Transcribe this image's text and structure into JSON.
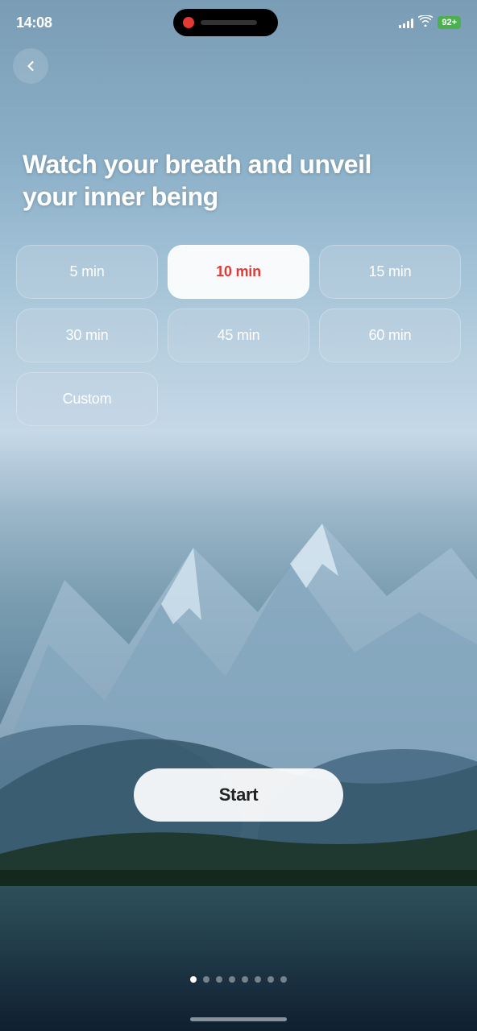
{
  "statusBar": {
    "time": "14:08",
    "battery": "92+",
    "batteryIcon": "⚡"
  },
  "backButton": {
    "label": "back"
  },
  "headline": {
    "text": "Watch your breath and unveil your inner being"
  },
  "durations": [
    {
      "label": "5 min",
      "value": 5,
      "selected": false
    },
    {
      "label": "10 min",
      "value": 10,
      "selected": true
    },
    {
      "label": "15 min",
      "value": 15,
      "selected": false
    },
    {
      "label": "30 min",
      "value": 30,
      "selected": false
    },
    {
      "label": "45 min",
      "value": 45,
      "selected": false
    },
    {
      "label": "60 min",
      "value": 60,
      "selected": false
    },
    {
      "label": "Custom",
      "value": "custom",
      "selected": false
    }
  ],
  "startButton": {
    "label": "Start"
  },
  "pageDots": {
    "total": 8,
    "active": 0
  }
}
